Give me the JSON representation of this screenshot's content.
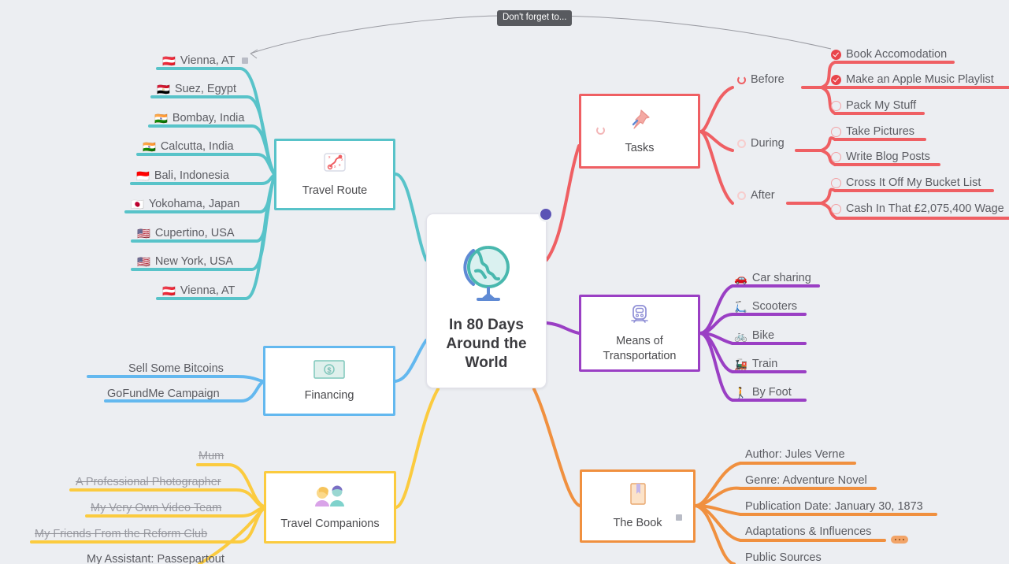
{
  "canvas": {
    "background": "#eceef2"
  },
  "tooltip": {
    "text": "Don't forget to..."
  },
  "central": {
    "title": "In 80 Days Around the World",
    "icon": "globe-icon",
    "badge_color": "#5b53b5"
  },
  "branches": {
    "travel_route": {
      "label": "Travel Route",
      "color": "#58c3c9",
      "icon": "route-map-icon",
      "children": [
        {
          "flag": "🇦🇹",
          "label": "Vienna, AT",
          "note": true
        },
        {
          "flag": "🇪🇬",
          "label": "Suez, Egypt"
        },
        {
          "flag": "🇮🇳",
          "label": "Bombay, India"
        },
        {
          "flag": "🇮🇳",
          "label": "Calcutta, India"
        },
        {
          "flag": "🇮🇩",
          "label": "Bali, Indonesia"
        },
        {
          "flag": "🇯🇵",
          "label": "Yokohama, Japan"
        },
        {
          "flag": "🇺🇸",
          "label": "Cupertino, USA"
        },
        {
          "flag": "🇺🇸",
          "label": "New York, USA"
        },
        {
          "flag": "🇦🇹",
          "label": "Vienna, AT"
        }
      ]
    },
    "tasks": {
      "label": "Tasks",
      "color": "#ef5f63",
      "icon": "pushpin-icon",
      "groups": [
        {
          "label": "Before",
          "items": [
            {
              "label": "Book Accomodation",
              "checked": true
            },
            {
              "label": "Make an Apple Music Playlist",
              "checked": true
            },
            {
              "label": "Pack My Stuff",
              "checked": false
            }
          ]
        },
        {
          "label": "During",
          "items": [
            {
              "label": "Take Pictures",
              "checked": false
            },
            {
              "label": "Write Blog Posts",
              "checked": false
            }
          ]
        },
        {
          "label": "After",
          "items": [
            {
              "label": "Cross It Off My Bucket List",
              "checked": false
            },
            {
              "label": "Cash In That £2,075,400 Wage",
              "checked": false
            }
          ]
        }
      ]
    },
    "transportation": {
      "label": "Means of Transportation",
      "color": "#9a3fc4",
      "icon": "train-icon",
      "children": [
        {
          "emoji": "🚗",
          "label": "Car sharing"
        },
        {
          "emoji": "🛴",
          "label": "Scooters"
        },
        {
          "emoji": "🚲",
          "label": "Bike"
        },
        {
          "emoji": "🚂",
          "label": "Train"
        },
        {
          "emoji": "🚶",
          "label": "By Foot"
        }
      ]
    },
    "financing": {
      "label": "Financing",
      "color": "#63b8ef",
      "icon": "banknote-icon",
      "children": [
        {
          "label": "Sell Some Bitcoins"
        },
        {
          "label": "GoFundMe Campaign"
        }
      ]
    },
    "travel_companions": {
      "label": "Travel Companions",
      "color": "#fbcb3f",
      "icon": "two-people-icon",
      "children": [
        {
          "label": "Mum",
          "struck": true
        },
        {
          "label": "A Professional Photographer",
          "struck": true
        },
        {
          "label": "My Very Own Video Team",
          "struck": true
        },
        {
          "label": "My Friends From the Reform Club",
          "struck": true
        },
        {
          "label": "My Assistant: Passepartout",
          "struck": false
        }
      ]
    },
    "the_book": {
      "label": "The Book",
      "color": "#f0903f",
      "icon": "book-icon",
      "note": true,
      "children": [
        {
          "label": "Author: Jules Verne"
        },
        {
          "label": "Genre: Adventure Novel"
        },
        {
          "label": "Publication Date: January 30, 1873"
        },
        {
          "label": "Adaptations & Influences",
          "more": true
        },
        {
          "label": "Public Sources"
        }
      ]
    }
  }
}
